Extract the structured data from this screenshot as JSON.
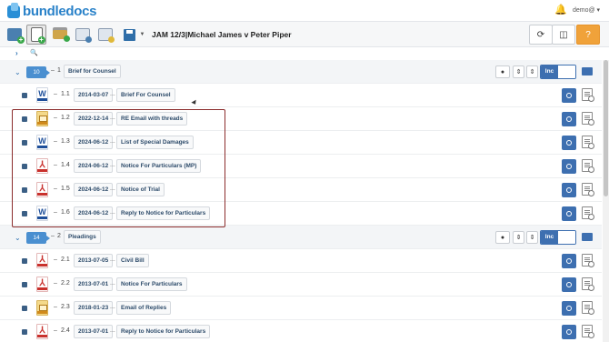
{
  "app": {
    "logo_text": "bundledocs",
    "user": "demo@ ▾"
  },
  "toolbar": {
    "case_title": "JAM 12/3|Michael James v Peter Piper"
  },
  "sections": [
    {
      "count": "10",
      "number": "1",
      "title": "Brief for Counsel",
      "inc_label": "Inc",
      "items": [
        {
          "num": "1.1",
          "date": "2014-03-07",
          "title": "Brief For Counsel",
          "type": "word"
        },
        {
          "num": "1.2",
          "date": "2022-12-14",
          "title": "RE Email with threads",
          "type": "email"
        },
        {
          "num": "1.3",
          "date": "2024-06-12",
          "title": "List of Special Damages",
          "type": "word"
        },
        {
          "num": "1.4",
          "date": "2024-06-12",
          "title": "Notice For Particulars (MP)",
          "type": "pdf"
        },
        {
          "num": "1.5",
          "date": "2024-06-12",
          "title": "Notice of Trial",
          "type": "pdf"
        },
        {
          "num": "1.6",
          "date": "2024-06-12",
          "title": "Reply to Notice for Particulars",
          "type": "word"
        }
      ]
    },
    {
      "count": "14",
      "number": "2",
      "title": "Pleadings",
      "inc_label": "Inc",
      "items": [
        {
          "num": "2.1",
          "date": "2013-07-05",
          "title": "Civil Bill",
          "type": "pdf"
        },
        {
          "num": "2.2",
          "date": "2013-07-01",
          "title": "Notice For Particulars",
          "type": "pdf"
        },
        {
          "num": "2.3",
          "date": "2018-01-23",
          "title": "Email of Replies",
          "type": "email"
        },
        {
          "num": "2.4",
          "date": "2013-07-01",
          "title": "Reply to Notice for Particulars",
          "type": "pdf"
        }
      ]
    }
  ],
  "filetype_glyphs": {
    "word": "W",
    "pdf": "⅄",
    "email": ""
  },
  "colors": {
    "accent": "#3d6fb0",
    "selection_border": "#8b2c2c",
    "help_button": "#f0a23a"
  }
}
